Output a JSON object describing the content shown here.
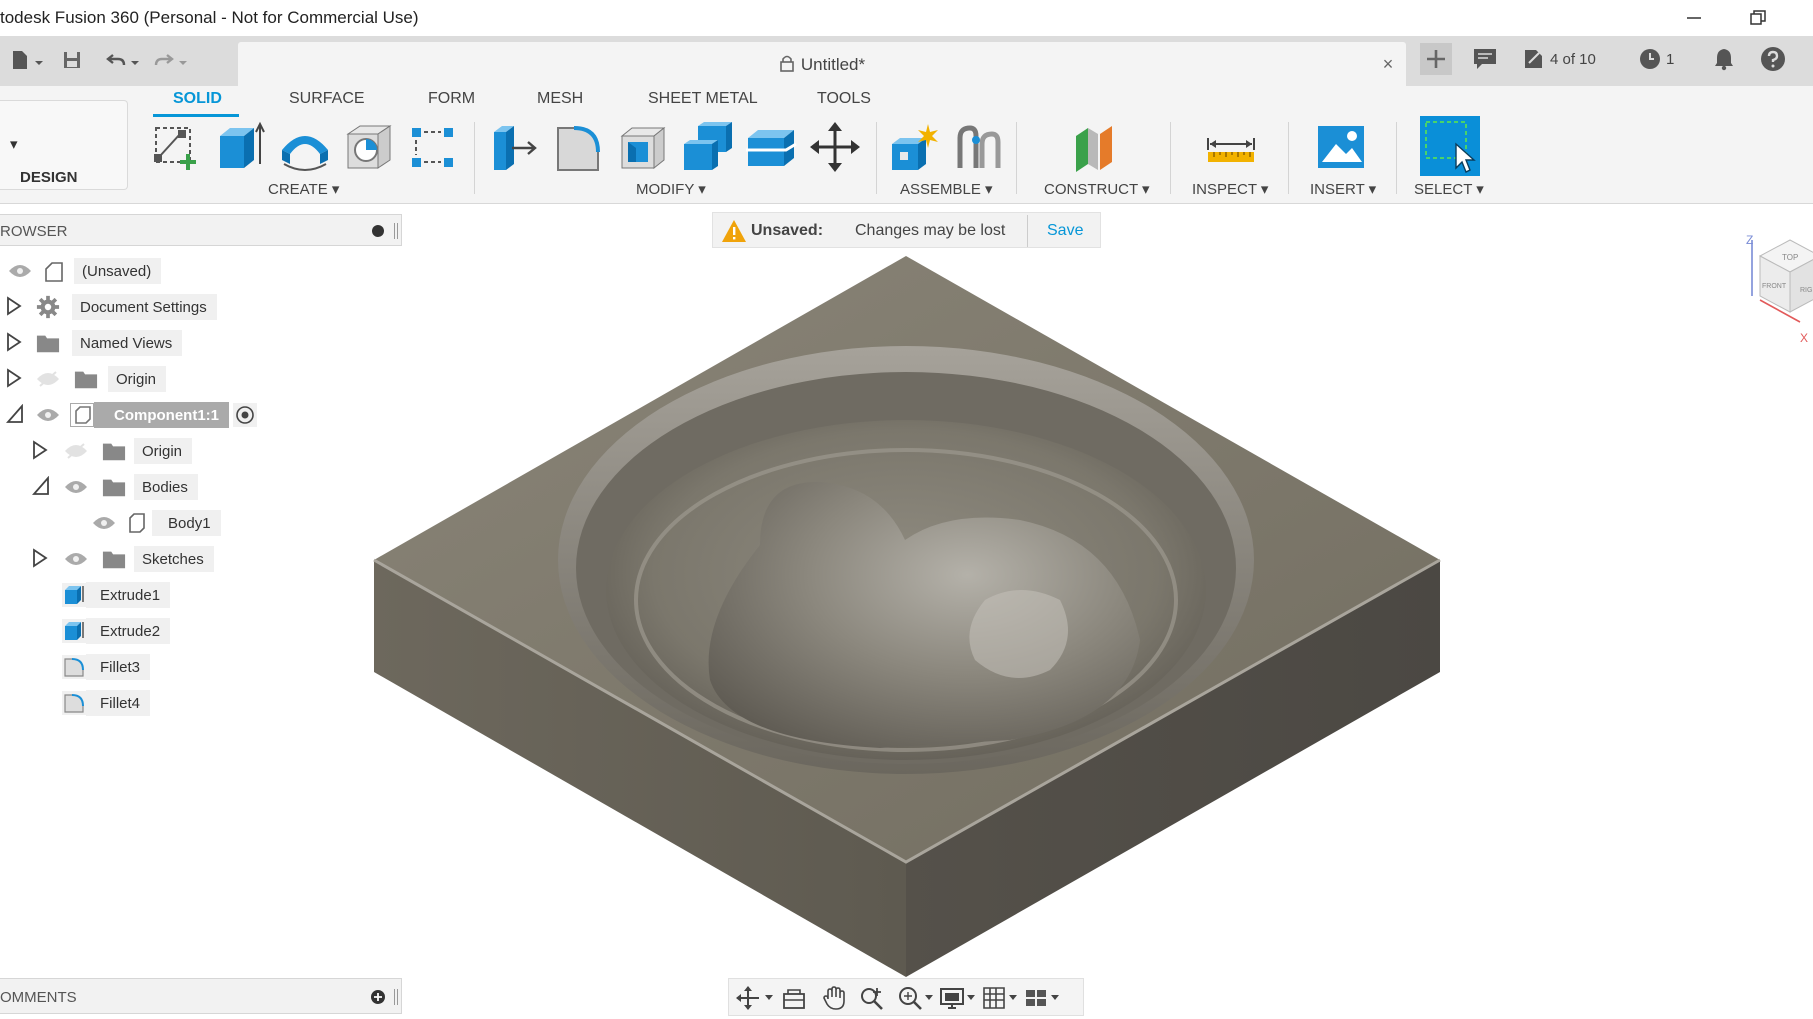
{
  "window": {
    "title": "todesk Fusion 360 (Personal - Not for Commercial Use)",
    "minimize_icon": "minimize-icon",
    "restore_icon": "restore-icon"
  },
  "document": {
    "title": "Untitled*",
    "close_glyph": "×"
  },
  "quick_access": {
    "job_status": "4 of 10",
    "history_count": "1"
  },
  "workspace": {
    "label": "DESIGN"
  },
  "ribbon_tabs": [
    {
      "label": "SOLID",
      "active": true
    },
    {
      "label": "SURFACE",
      "active": false
    },
    {
      "label": "FORM",
      "active": false
    },
    {
      "label": "MESH",
      "active": false
    },
    {
      "label": "SHEET METAL",
      "active": false
    },
    {
      "label": "TOOLS",
      "active": false
    }
  ],
  "ribbon_groups": {
    "create": "CREATE",
    "modify": "MODIFY",
    "assemble": "ASSEMBLE",
    "construct": "CONSTRUCT",
    "inspect": "INSPECT",
    "insert": "INSERT",
    "select": "SELECT"
  },
  "browser": {
    "header": "ROWSER",
    "nodes": {
      "root": "(Unsaved)",
      "document_settings": "Document Settings",
      "named_views": "Named Views",
      "origin": "Origin",
      "component": "Component1:1",
      "comp_origin": "Origin",
      "bodies": "Bodies",
      "body1": "Body1",
      "sketches": "Sketches",
      "extrude1": "Extrude1",
      "extrude2": "Extrude2",
      "fillet3": "Fillet3",
      "fillet4": "Fillet4"
    }
  },
  "unsaved_bar": {
    "label": "Unsaved:",
    "message": "Changes may be lost",
    "save": "Save"
  },
  "comments": {
    "header": "OMMENTS"
  },
  "viewcube": {
    "axis_z": "Z",
    "axis_x": "X",
    "face_top": "TOP",
    "face_front": "FRONT",
    "face_right": "RIG"
  },
  "colors": {
    "accent": "#0696d7",
    "model": "#7b7669",
    "warning": "#f0a30a"
  }
}
